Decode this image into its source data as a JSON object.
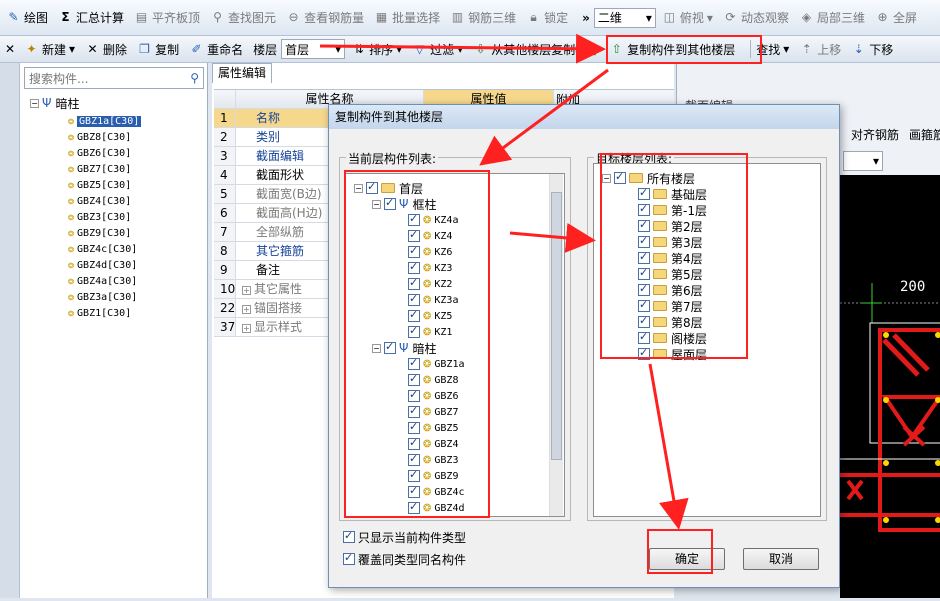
{
  "toolbar1": {
    "items": [
      "绘图",
      "汇总计算",
      "平齐板顶",
      "查找图元",
      "查看钢筋量",
      "批量选择",
      "钢筋三维",
      "锁定"
    ],
    "view_combo": "二维",
    "view_dir": "俯视",
    "dynamic": "动态观察",
    "local3d": "局部三维",
    "fullscreen": "全屏"
  },
  "toolbar2": {
    "new": "新建",
    "delete": "删除",
    "copy": "复制",
    "rename": "重命名",
    "floor_label": "楼层",
    "floor_value": "首层",
    "sort": "排序",
    "filter": "过滤",
    "copy_from": "从其他楼层复制构件",
    "copy_to": "复制构件到其他楼层",
    "find": "查找",
    "move_up": "上移",
    "move_down": "下移"
  },
  "tree": {
    "search_placeholder": "搜索构件...",
    "root": "暗柱",
    "items": [
      "GBZ1a[C30]",
      "GBZ8[C30]",
      "GBZ6[C30]",
      "GBZ7[C30]",
      "GBZ5[C30]",
      "GBZ4[C30]",
      "GBZ3[C30]",
      "GBZ9[C30]",
      "GBZ4c[C30]",
      "GBZ4d[C30]",
      "GBZ4a[C30]",
      "GBZ3a[C30]",
      "GBZ1[C30]"
    ]
  },
  "props": {
    "tab": "属性编辑",
    "col_name": "属性名称",
    "col_value": "属性值",
    "col_extra": "附加",
    "rows": [
      {
        "n": "1",
        "name": "名称",
        "style": "blue"
      },
      {
        "n": "2",
        "name": "类别",
        "style": "blue"
      },
      {
        "n": "3",
        "name": "截面编辑",
        "style": "blue"
      },
      {
        "n": "4",
        "name": "截面形状",
        "style": ""
      },
      {
        "n": "5",
        "name": "截面宽(B边)",
        "style": "grey"
      },
      {
        "n": "6",
        "name": "截面高(H边)",
        "style": "grey"
      },
      {
        "n": "7",
        "name": "全部纵筋",
        "style": "grey"
      },
      {
        "n": "8",
        "name": "其它箍筋",
        "style": "blue"
      },
      {
        "n": "9",
        "name": "备注",
        "style": ""
      },
      {
        "n": "10",
        "name": "其它属性",
        "style": "grey",
        "expand": true
      },
      {
        "n": "22",
        "name": "锚固搭接",
        "style": "grey",
        "expand": true
      },
      {
        "n": "37",
        "name": "显示样式",
        "style": "grey",
        "expand": true
      }
    ]
  },
  "right_panel": {
    "header": "截面编辑",
    "btn_align": "对齐钢筋",
    "btn_draw": "画箍筋",
    "dim": "200"
  },
  "dialog": {
    "title": "复制构件到其他楼层",
    "src_label": "当前层构件列表:",
    "dst_label": "目标楼层列表:",
    "src_root": "首层",
    "src_group1": "框柱",
    "src_group1_items": [
      "KZ4a",
      "KZ4",
      "KZ6",
      "KZ3",
      "KZ2",
      "KZ3a",
      "KZ5",
      "KZ1"
    ],
    "src_group2": "暗柱",
    "src_group2_items": [
      "GBZ1a",
      "GBZ8",
      "GBZ6",
      "GBZ7",
      "GBZ5",
      "GBZ4",
      "GBZ3",
      "GBZ9",
      "GBZ4c",
      "GBZ4d"
    ],
    "dst_root": "所有楼层",
    "dst_items": [
      "基础层",
      "第-1层",
      "第2层",
      "第3层",
      "第4层",
      "第5层",
      "第6层",
      "第7层",
      "第8层",
      "阁楼层",
      "屋面层"
    ],
    "opt1": "只显示当前构件类型",
    "opt2": "覆盖同类型同名构件",
    "ok": "确定",
    "cancel": "取消"
  },
  "colors": {
    "annotation": "#ff2020",
    "selection": "#2a5db0"
  }
}
